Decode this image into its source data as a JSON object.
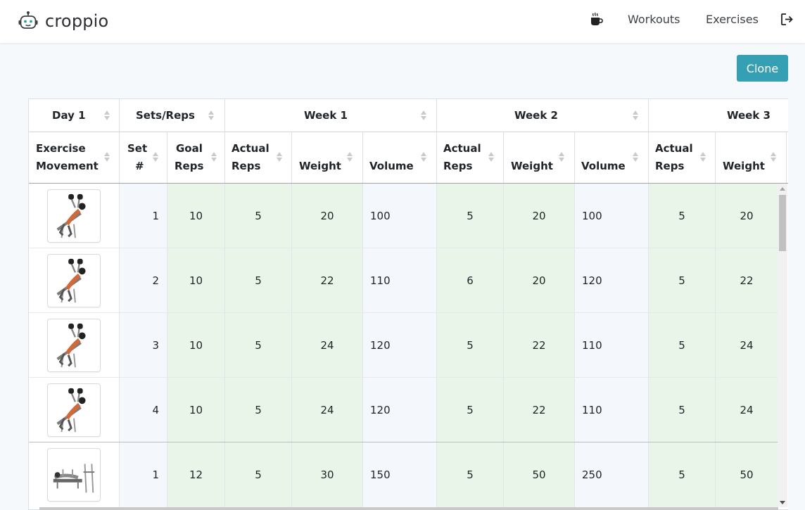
{
  "app": {
    "name": "croppio"
  },
  "nav": {
    "coffee_icon": "coffee-icon",
    "workouts": "Workouts",
    "exercises": "Exercises",
    "logout_icon": "logout-icon"
  },
  "toolbar": {
    "clone_label": "Clone"
  },
  "table": {
    "group_headers": {
      "day": "Day 1",
      "sets_reps": "Sets/Reps",
      "week1": "Week 1",
      "week2": "Week 2",
      "week3": "Week 3"
    },
    "columns": {
      "exercise_line1": "Exercise",
      "exercise_line2": "Movement",
      "set_line1": "Set",
      "set_line2": "#",
      "goal_line1": "Goal",
      "goal_line2": "Reps",
      "actual_line1": "Actual",
      "actual_line2": "Reps",
      "weight": "Weight",
      "volume": "Volume"
    },
    "rows": [
      {
        "exercise": "incline-dumbbell-press",
        "set": "1",
        "goal": "10",
        "w1": {
          "reps": "5",
          "weight": "20",
          "volume": "100"
        },
        "w2": {
          "reps": "5",
          "weight": "20",
          "volume": "100"
        },
        "w3": {
          "reps": "5",
          "weight": "20"
        }
      },
      {
        "exercise": "incline-dumbbell-press",
        "set": "2",
        "goal": "10",
        "w1": {
          "reps": "5",
          "weight": "22",
          "volume": "110"
        },
        "w2": {
          "reps": "6",
          "weight": "20",
          "volume": "120"
        },
        "w3": {
          "reps": "5",
          "weight": "22"
        }
      },
      {
        "exercise": "incline-dumbbell-press",
        "set": "3",
        "goal": "10",
        "w1": {
          "reps": "5",
          "weight": "24",
          "volume": "120"
        },
        "w2": {
          "reps": "5",
          "weight": "22",
          "volume": "110"
        },
        "w3": {
          "reps": "5",
          "weight": "24"
        }
      },
      {
        "exercise": "incline-dumbbell-press",
        "set": "4",
        "goal": "10",
        "w1": {
          "reps": "5",
          "weight": "24",
          "volume": "120"
        },
        "w2": {
          "reps": "5",
          "weight": "22",
          "volume": "110"
        },
        "w3": {
          "reps": "5",
          "weight": "24"
        }
      },
      {
        "exercise": "barbell-bench-press",
        "set": "1",
        "goal": "12",
        "w1": {
          "reps": "5",
          "weight": "30",
          "volume": "150"
        },
        "w2": {
          "reps": "5",
          "weight": "50",
          "volume": "250"
        },
        "w3": {
          "reps": "5",
          "weight": "50"
        }
      }
    ]
  }
}
